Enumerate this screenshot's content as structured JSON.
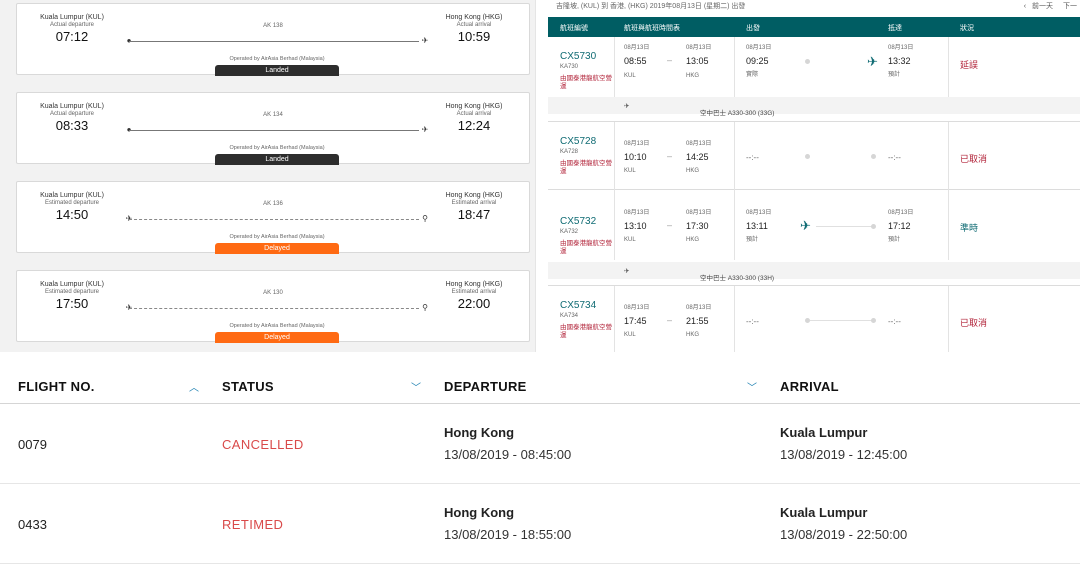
{
  "airasia": {
    "cards": [
      {
        "origin": "Kuala Lumpur (KUL)",
        "dep_kind": "Actual departure",
        "dep_time": "07:12",
        "flight": "AK 138",
        "dest": "Hong Kong (HKG)",
        "arr_kind": "Actual arrival",
        "arr_time": "10:59",
        "operated": "Operated by AirAsia Berhad (Malaysia)",
        "status": "Landed",
        "status_type": "landed"
      },
      {
        "origin": "Kuala Lumpur (KUL)",
        "dep_kind": "Actual departure",
        "dep_time": "08:33",
        "flight": "AK 134",
        "dest": "Hong Kong (HKG)",
        "arr_kind": "Actual arrival",
        "arr_time": "12:24",
        "operated": "Operated by AirAsia Berhad (Malaysia)",
        "status": "Landed",
        "status_type": "landed"
      },
      {
        "origin": "Kuala Lumpur (KUL)",
        "dep_kind": "Estimated departure",
        "dep_time": "14:50",
        "flight": "AK 136",
        "dest": "Hong Kong (HKG)",
        "arr_kind": "Estimated arrival",
        "arr_time": "18:47",
        "operated": "Operated by AirAsia Berhad (Malaysia)",
        "status": "Delayed",
        "status_type": "delayed"
      },
      {
        "origin": "Kuala Lumpur (KUL)",
        "dep_kind": "Estimated departure",
        "dep_time": "17:50",
        "flight": "AK 130",
        "dest": "Hong Kong (HKG)",
        "arr_kind": "Estimated arrival",
        "arr_time": "22:00",
        "operated": "Operated by AirAsia Berhad (Malaysia)",
        "status": "Delayed",
        "status_type": "delayed"
      }
    ]
  },
  "cathay": {
    "route_line": "吉隆坡, (KUL) 到 香港, (HKG) 2019年08月13日 (星期二) 出發",
    "nav_prev": "前一天",
    "nav_next": "下一",
    "headers": {
      "flight": "航班編號",
      "schedule": "航班與航班時間表",
      "departure": "出發",
      "arrival": "抵達",
      "status": "狀況"
    },
    "flights": [
      {
        "flight": "CX5730",
        "code": "KA730",
        "operated": "由國泰港龍航空營運",
        "sched_dep_date": "08月13日",
        "sched_dep": "08:55",
        "sched_dep_ap": "KUL",
        "sched_arr_date": "08月13日",
        "sched_arr": "13:05",
        "sched_arr_ap": "HKG",
        "dep_date": "08月13日",
        "dep_time": "09:25",
        "dep_note": "實際",
        "arr_date": "08月13日",
        "arr_time": "13:32",
        "arr_note": "預計",
        "status": "延誤",
        "aircraft": "空中巴士 A330-300 (33G)"
      },
      {
        "flight": "CX5728",
        "code": "KA728",
        "operated": "由國泰港龍航空營運",
        "sched_dep_date": "08月13日",
        "sched_dep": "10:10",
        "sched_dep_ap": "KUL",
        "sched_arr_date": "08月13日",
        "sched_arr": "14:25",
        "sched_arr_ap": "HKG",
        "dep_time": "--:--",
        "arr_time": "--:--",
        "status": "已取消"
      },
      {
        "flight": "CX5732",
        "code": "KA732",
        "operated": "由國泰港龍航空營運",
        "sched_dep_date": "08月13日",
        "sched_dep": "13:10",
        "sched_dep_ap": "KUL",
        "sched_arr_date": "08月13日",
        "sched_arr": "17:30",
        "sched_arr_ap": "HKG",
        "dep_date": "08月13日",
        "dep_time": "13:11",
        "dep_note": "預計",
        "arr_date": "08月13日",
        "arr_time": "17:12",
        "arr_note": "預計",
        "status": "準時",
        "aircraft": "空中巴士 A330-300 (33H)"
      },
      {
        "flight": "CX5734",
        "code": "KA734",
        "operated": "由國泰港龍航空營運",
        "sched_dep_date": "08月13日",
        "sched_dep": "17:45",
        "sched_dep_ap": "KUL",
        "sched_arr_date": "08月13日",
        "sched_arr": "21:55",
        "sched_arr_ap": "HKG",
        "dep_time": "--:--",
        "arr_time": "--:--",
        "status": "已取消"
      }
    ]
  },
  "mas": {
    "headers": {
      "flight_no": "FLIGHT NO.",
      "status": "STATUS",
      "departure": "DEPARTURE",
      "arrival": "ARRIVAL"
    },
    "rows": [
      {
        "flight_no": "0079",
        "status": "CANCELLED",
        "dep_city": "Hong Kong",
        "dep_datetime": "13/08/2019 - 08:45:00",
        "arr_city": "Kuala Lumpur",
        "arr_datetime": "13/08/2019 - 12:45:00"
      },
      {
        "flight_no": "0433",
        "status": "RETIMED",
        "dep_city": "Hong Kong",
        "dep_datetime": "13/08/2019 - 18:55:00",
        "arr_city": "Kuala Lumpur",
        "arr_datetime": "13/08/2019 - 22:50:00"
      }
    ]
  },
  "colors": {
    "airasia_landed": "#2d2d2d",
    "airasia_delayed": "#ff6a13",
    "cathay_teal": "#005d63",
    "cathay_red": "#b2243a",
    "mas_red": "#d94a4a",
    "mas_chevron": "#1a7fb0"
  },
  "icons": {
    "aa_dep": "dot-icon",
    "aa_arr_landed": "plane-icon",
    "aa_arr_est": "pin-icon",
    "cx_plane": "plane-icon",
    "mh_sort": "chevron-icon"
  }
}
